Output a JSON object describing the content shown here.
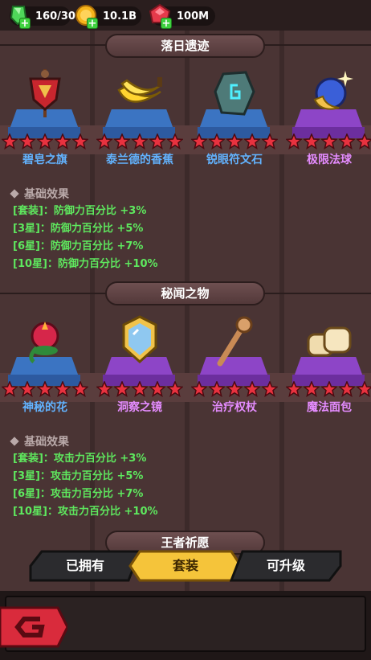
{
  "currencies": [
    {
      "icon": "green-gem-icon",
      "value": "160/30"
    },
    {
      "icon": "gold-coin-icon",
      "value": "10.1B"
    },
    {
      "icon": "ruby-icon",
      "value": "100M"
    }
  ],
  "sections": [
    {
      "title": "落日遗迹",
      "items": [
        {
          "name": "碧皂之旗",
          "rarity": "blue",
          "stars": 5,
          "icon": "banner-icon"
        },
        {
          "name": "泰兰德的香蕉",
          "rarity": "blue",
          "stars": 5,
          "icon": "banana-icon"
        },
        {
          "name": "锐眼符文石",
          "rarity": "blue",
          "stars": 5,
          "icon": "rune-stone-icon"
        },
        {
          "name": "极限法球",
          "rarity": "purple",
          "stars": 5,
          "icon": "magic-orb-icon"
        }
      ],
      "effect_title": "基础效果",
      "effects": [
        "[套装]：防御力百分比 +3%",
        "[3星]：防御力百分比 +5%",
        "[6星]：防御力百分比 +7%",
        "[10星]：防御力百分比 +10%"
      ]
    },
    {
      "title": "秘闻之物",
      "items": [
        {
          "name": "神秘的花",
          "rarity": "blue",
          "stars": 5,
          "icon": "flower-icon"
        },
        {
          "name": "洞察之镜",
          "rarity": "purple",
          "stars": 5,
          "icon": "mirror-icon"
        },
        {
          "name": "治疗权杖",
          "rarity": "purple",
          "stars": 5,
          "icon": "staff-icon"
        },
        {
          "name": "魔法面包",
          "rarity": "purple",
          "stars": 5,
          "icon": "bread-icon"
        }
      ],
      "effect_title": "基础效果",
      "effects": [
        "[套装]：攻击力百分比 +3%",
        "[3星]：攻击力百分比 +5%",
        "[6星]：攻击力百分比 +7%",
        "[10星]：攻击力百分比 +10%"
      ]
    }
  ],
  "next_section_title": "王者祈愿",
  "tabs": [
    {
      "label": "已拥有",
      "active": false
    },
    {
      "label": "套装",
      "active": true
    },
    {
      "label": "可升级",
      "active": false
    }
  ],
  "colors": {
    "accent_tab": "#f5c43a",
    "blue_name": "#62b3ff",
    "purple_name": "#e58cff",
    "effect_green": "#5ee85e"
  }
}
